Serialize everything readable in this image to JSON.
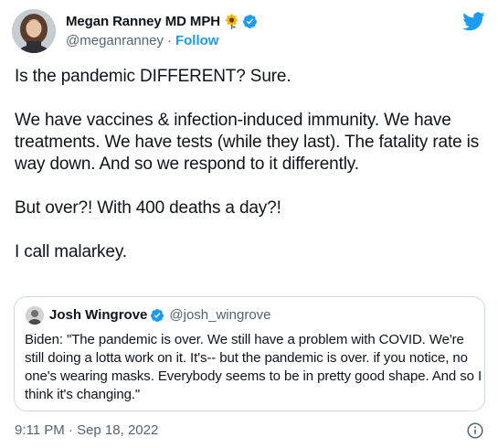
{
  "author": {
    "name": "Megan Ranney MD MPH",
    "emoji_icon": "sunflower-icon",
    "handle": "@meganranney",
    "separator": "·",
    "follow_label": "Follow"
  },
  "tweet_text": "Is the pandemic DIFFERENT? Sure.\n\nWe have vaccines & infection-induced immunity. We have treatments. We have tests (while they last). The fatality rate is way down. And so we respond to it differently.\n\nBut over?! With 400 deaths a day?!\n\nI call malarkey.",
  "quoted_tweet": {
    "name": "Josh Wingrove",
    "handle": "@josh_wingrove",
    "text": "Biden: \"The pandemic is over. We still have a problem with COVID. We're still doing a lotta work on it. It's-- but the pandemic is over. if you notice, no one's wearing masks. Everybody seems to be in pretty good shape. And so I think it's changing.\""
  },
  "timestamp": "9:11 PM · Sep 18, 2022",
  "colors": {
    "accent": "#1d9bf0",
    "text": "#0f1419",
    "secondary": "#536471",
    "border": "#cfd9de"
  }
}
